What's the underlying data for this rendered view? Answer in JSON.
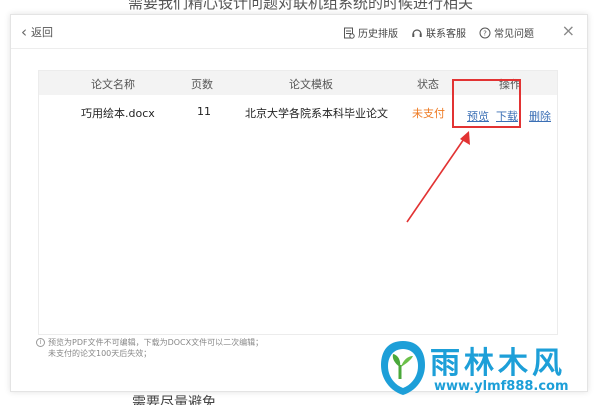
{
  "background": {
    "top_text": "需要我们精心设计问题对联机组系统的时候进行相关",
    "bottom_text": "需要尽量避免"
  },
  "titlebar": {
    "back_label": "返回",
    "history_label": "历史排版",
    "support_label": "联系客服",
    "faq_label": "常见问题",
    "close_glyph": "×"
  },
  "table": {
    "headers": [
      "论文名称",
      "页数",
      "论文模板",
      "状态",
      "操作"
    ],
    "rows": [
      {
        "name": "巧用绘本.docx",
        "pages": "11",
        "template": "北京大学各院系本科毕业论文",
        "status": "未支付",
        "preview": "预览",
        "download": "下载",
        "delete": "删除"
      }
    ]
  },
  "note": {
    "line1": "预览为PDF文件不可编辑，下载为DOCX文件可以二次编辑；",
    "line2": "未支付的论文100天后失效；"
  },
  "watermark": {
    "title": "雨林木风",
    "url": "www.ylmf888.com"
  },
  "colors": {
    "accent_status": "#ee7a22",
    "link": "#3b6fb5",
    "highlight": "#e23333",
    "watermark": "#1d9fd8"
  }
}
